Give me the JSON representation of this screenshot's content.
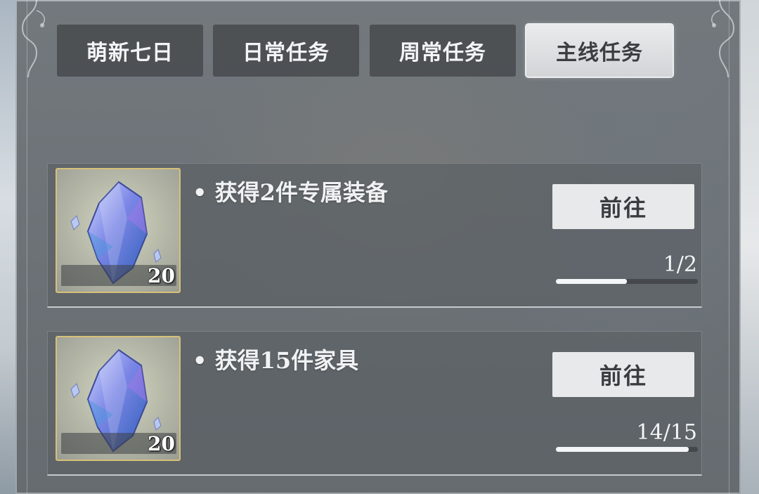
{
  "tabs": [
    {
      "label": "萌新七日",
      "active": false
    },
    {
      "label": "日常任务",
      "active": false
    },
    {
      "label": "周常任务",
      "active": false
    },
    {
      "label": "主线任务",
      "active": true
    }
  ],
  "quests": [
    {
      "title": "• 获得2件专属装备",
      "reward_icon": "crystal-icon",
      "reward_count": "20",
      "button_label": "前往",
      "progress_text": "1/2",
      "progress_fraction": 0.5
    },
    {
      "title": "• 获得15件家具",
      "reward_icon": "crystal-icon",
      "reward_count": "20",
      "button_label": "前往",
      "progress_text": "14/15",
      "progress_fraction": 0.9333
    }
  ],
  "colors": {
    "active_tab": "#dfe1e3",
    "inactive_tab": "#46494d",
    "reward_border": "#d8c07a",
    "crystal": "#6c79d9"
  }
}
